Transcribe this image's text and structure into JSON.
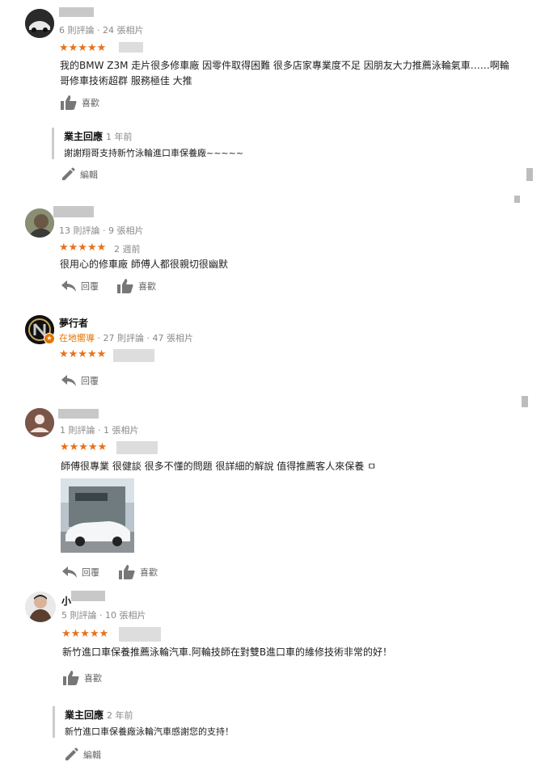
{
  "reviews": [
    {
      "meta": "6 則評論 · 24 張相片",
      "stars": "★★★★★",
      "text": "我的BMW Z3M 走片很多修車廠 因零件取得困難 很多店家專業度不足 因朋友大力推薦泳輪氣車……啊輪哥修車技術超群 服務極佳 大推",
      "like_label": "喜歡",
      "owner_reply": {
        "label": "業主回應",
        "time": "1 年前",
        "text": "謝謝翔哥支持新竹泳輪進口車保養廠~~~~~"
      },
      "edit_label": "編輯"
    },
    {
      "meta": "13 則評論 · 9 張相片",
      "stars": "★★★★★",
      "time": "2 週前",
      "text": "很用心的修車廠 師傅人都很親切很幽默",
      "reply_label": "回覆",
      "like_label": "喜歡"
    },
    {
      "name": "夢行者",
      "guide": "在地嚮導",
      "meta": "· 27 則評論 · 47 張相片",
      "stars": "★★★★★",
      "reply_label": "回覆"
    },
    {
      "meta": "1 則評論 · 1 張相片",
      "stars": "★★★★★",
      "text": "師傅很專業 很健談 很多不懂的問題 很詳細的解說 值得推薦客人來保養 ㅁ",
      "reply_label": "回覆",
      "like_label": "喜歡"
    },
    {
      "name": "小",
      "meta": "5 則評論 · 10 張相片",
      "stars": "★★★★★",
      "text": "新竹進口車保養推薦泳輪汽車.阿輪技師在對雙B進口車的維修技術非常的好！",
      "like_label": "喜歡",
      "owner_reply": {
        "label": "業主回應",
        "time": "2 年前",
        "text": "新竹進口車保養廠泳輪汽車感謝您的支持！"
      },
      "edit_label": "編輯"
    }
  ],
  "colors": {
    "star": "#e7711b",
    "guide": "#e37400",
    "meta": "#888888"
  },
  "icons": [
    "thumb-up-icon",
    "reply-icon",
    "pencil-icon",
    "local-guide-badge-icon"
  ]
}
